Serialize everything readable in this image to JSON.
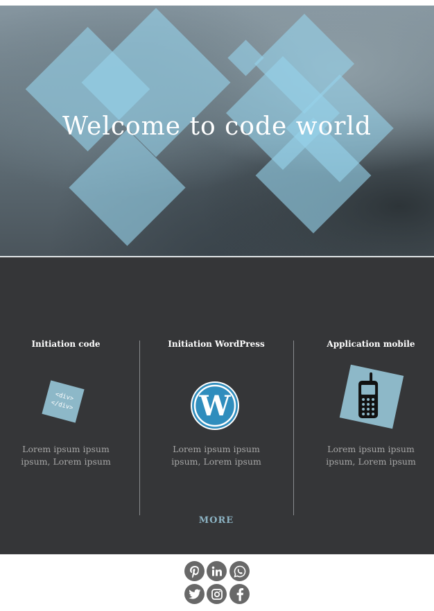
{
  "hero": {
    "title": "Welcome to code world"
  },
  "services": {
    "columns": [
      {
        "title": "Initiation code",
        "icon": "code-icon",
        "icon_text": [
          "<div>",
          "</div>"
        ],
        "text": "Lorem ipsum ipsum ipsum, Lorem ipsum"
      },
      {
        "title": "Initiation WordPress",
        "icon": "wordpress-icon",
        "text": "Lorem ipsum ipsum ipsum, Lorem ipsum"
      },
      {
        "title": "Application mobile",
        "icon": "mobile-phone-icon",
        "text": "Lorem ipsum ipsum ipsum, Lorem ipsum"
      }
    ],
    "more_label": "MORE"
  },
  "footer": {
    "social_icons": [
      "pinterest-icon",
      "linkedin-icon",
      "whatsapp-icon",
      "twitter-icon",
      "instagram-icon",
      "facebook-icon"
    ]
  },
  "colors": {
    "dark_section": "#353638",
    "accent": "#8db8c8",
    "diamond": "#96d2ea",
    "social_gray": "#686868"
  }
}
